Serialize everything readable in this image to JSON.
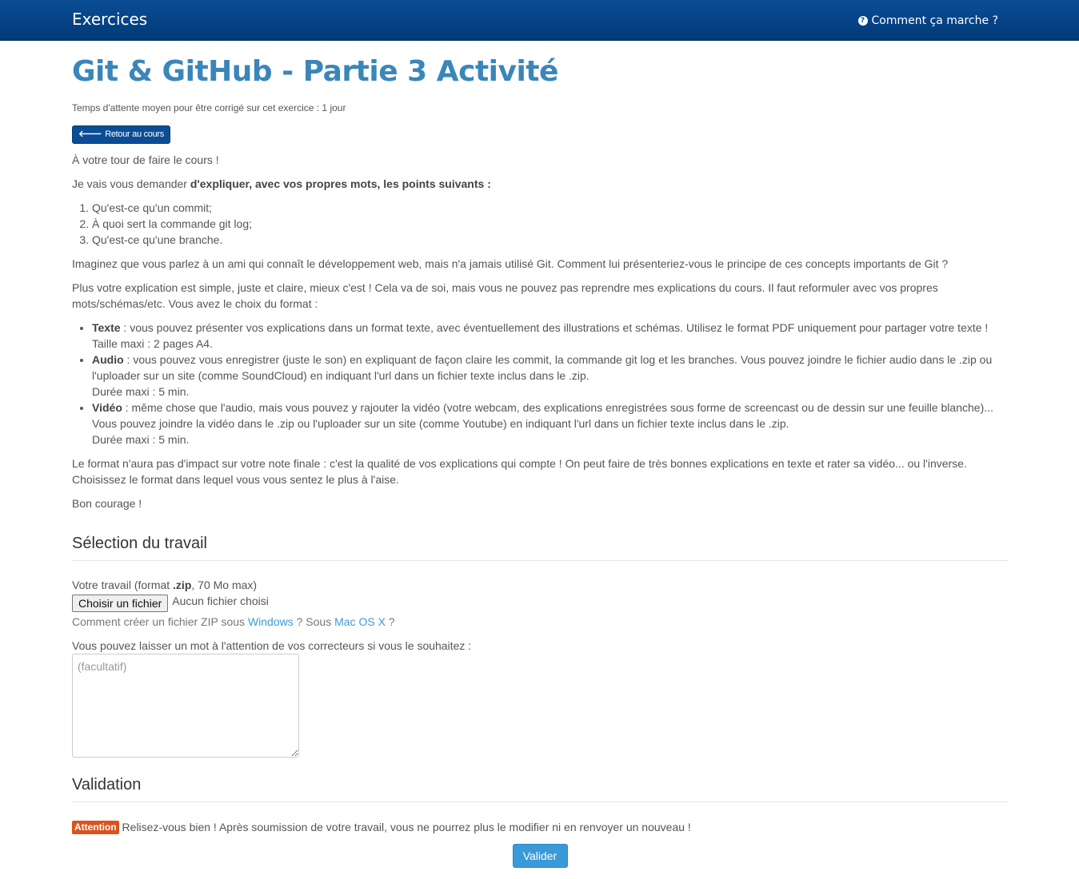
{
  "header": {
    "brand": "Exercices",
    "help_link": "Comment ça marche ?"
  },
  "page": {
    "title": "Git & GitHub - Partie 3 Activité",
    "wait_time": "Temps d'attente moyen pour être corrigé sur cet exercice : 1 jour",
    "back_button": "Retour au cours"
  },
  "instructions": {
    "intro": "À votre tour de faire le cours !",
    "ask_prefix": "Je vais vous demander ",
    "ask_bold": "d'expliquer, avec vos propres mots, les points suivants :",
    "points": [
      "Qu'est-ce qu'un commit;",
      "À quoi sert la commande git log;",
      "Qu'est-ce qu'une branche."
    ],
    "imagine": "Imaginez que vous parlez à un ami qui connaît le développement web, mais n'a jamais utilisé Git. Comment lui présenteriez-vous le principe de ces concepts importants de Git ?",
    "simple": "Plus votre explication est simple, juste et claire, mieux c'est ! Cela va de soi, mais vous ne pouvez pas reprendre mes explications du cours. Il faut reformuler avec vos propres mots/schémas/etc. Vous avez le choix du format :",
    "formats": [
      {
        "name": "Texte",
        "desc": " : vous pouvez présenter vos explications dans un format texte, avec éventuellement des illustrations et schémas. Utilisez le format PDF uniquement pour partager votre texte !",
        "limit": "Taille maxi : 2 pages A4."
      },
      {
        "name": "Audio",
        "desc": " : vous pouvez vous enregistrer (juste le son) en expliquant de façon claire les commit, la commande git log et les branches. Vous pouvez joindre le fichier audio dans le .zip ou l'uploader sur un site (comme SoundCloud) en indiquant l'url dans un fichier texte inclus dans le .zip.",
        "limit": "Durée maxi : 5 min."
      },
      {
        "name": "Vidéo",
        "desc": " : même chose que l'audio, mais vous pouvez y rajouter la vidéo (votre webcam, des explications enregistrées sous forme de screencast ou de dessin sur une feuille blanche)... Vous pouvez joindre la vidéo dans le .zip ou l'uploader sur un site (comme Youtube) en indiquant l'url dans un fichier texte inclus dans le .zip.",
        "limit": "Durée maxi : 5 min."
      }
    ],
    "impact": "Le format n'aura pas d'impact sur votre note finale : c'est la qualité de vos explications qui compte ! On peut faire de très bonnes explications en texte et rater sa vidéo... ou l'inverse. Choisissez le format dans lequel vous vous sentez le plus à l'aise.",
    "good_luck": "Bon courage !"
  },
  "selection": {
    "heading": "Sélection du travail",
    "label_prefix": "Votre travail (format ",
    "label_bold": ".zip",
    "label_suffix": ", 70 Mo max)",
    "file_button": "Choisir un fichier",
    "file_status": "Aucun fichier choisi",
    "zip_help_prefix": "Comment créer un fichier ZIP sous ",
    "zip_help_windows": "Windows",
    "zip_help_middle": " ? Sous ",
    "zip_help_mac": "Mac OS X",
    "zip_help_suffix": " ?",
    "note_label": "Vous pouvez laisser un mot à l'attention de vos correcteurs si vous le souhaitez :",
    "note_placeholder": "(facultatif)"
  },
  "validation": {
    "heading": "Validation",
    "badge": "Attention",
    "warning": " Relisez-vous bien ! Après soumission de votre travail, vous ne pourrez plus le modifier ni en renvoyer un nouveau !",
    "submit": "Valider"
  },
  "colors": {
    "header_bg": "#0b4d94",
    "title": "#3a86b9",
    "link": "#3a9ad9",
    "attention": "#d9531e",
    "submit": "#3a9ad9"
  }
}
